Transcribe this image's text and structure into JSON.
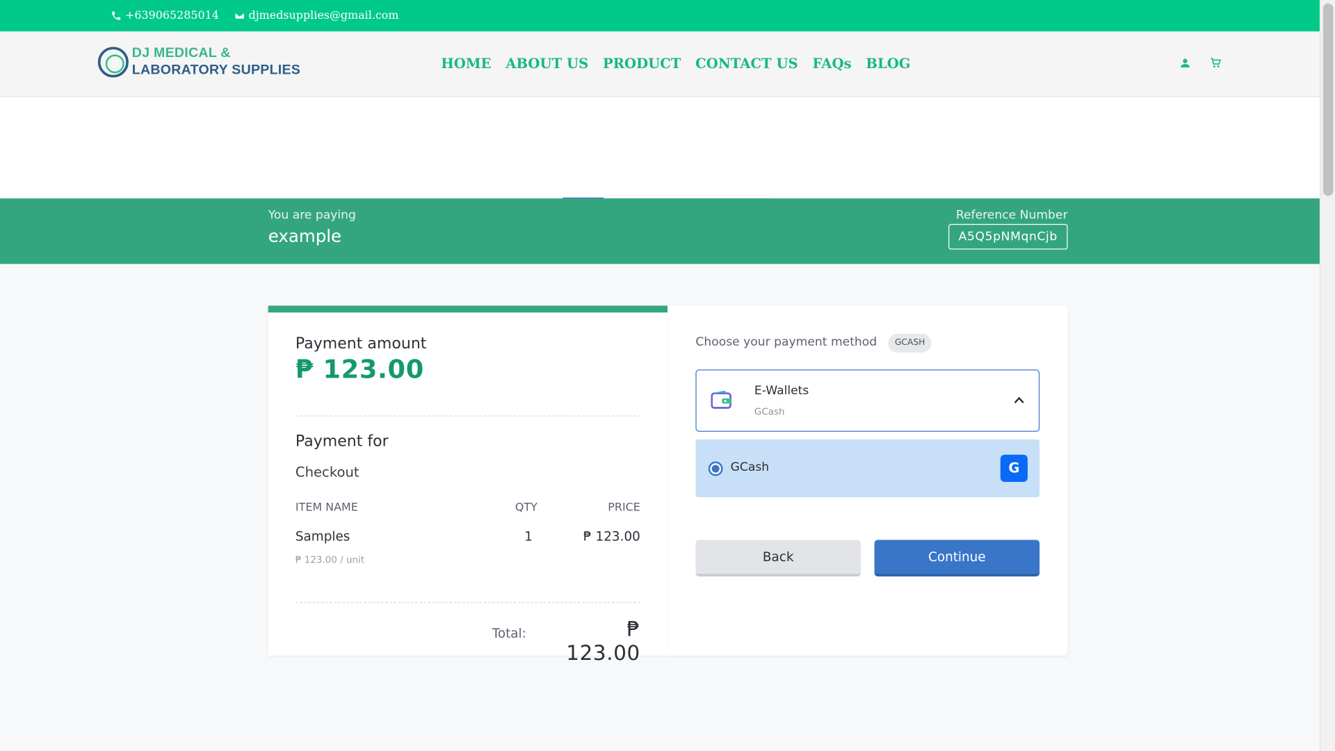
{
  "topbar": {
    "phone": "+639065285014",
    "email": "djmedsupplies@gmail.com"
  },
  "brand": {
    "line1": "DJ MEDICAL &",
    "line2": "LABORATORY SUPPLIES"
  },
  "nav": {
    "items": [
      {
        "label": "HOME"
      },
      {
        "label": "ABOUT US"
      },
      {
        "label": "PRODUCT"
      },
      {
        "label": "CONTACT US"
      },
      {
        "label": "FAQs"
      },
      {
        "label": "BLOG"
      }
    ],
    "icons": [
      "user-icon",
      "cart-icon"
    ]
  },
  "pay_header": {
    "paying_label": "You are paying",
    "merchant": "example",
    "reference_label": "Reference Number",
    "reference_number": "A5Q5pNMqnCjb"
  },
  "summary": {
    "amount_label": "Payment amount",
    "amount": "₱ 123.00",
    "payment_for_label": "Payment for",
    "payment_for": "Checkout",
    "columns": {
      "item": "ITEM NAME",
      "qty": "QTY",
      "price": "PRICE"
    },
    "items": [
      {
        "name": "Samples",
        "qty": "1",
        "price": "₱ 123.00",
        "unit_price": "₱ 123.00 / unit"
      }
    ],
    "total_label": "Total:",
    "total": "₱ 123.00"
  },
  "payment": {
    "choose_label": "Choose your payment method",
    "selected_badge": "GCASH",
    "group": {
      "title": "E-Wallets",
      "subtitle": "GCash",
      "icon": "wallet-icon",
      "expanded": true
    },
    "options": [
      {
        "label": "GCash",
        "selected": true,
        "logo_glyph": "G"
      }
    ],
    "back_label": "Back",
    "continue_label": "Continue"
  },
  "colors": {
    "topbar": "#00c98a",
    "header_band": "#34a67f",
    "accent_green": "#14996b",
    "primary_blue": "#3a76c8",
    "option_bg": "#c8e0f7"
  }
}
